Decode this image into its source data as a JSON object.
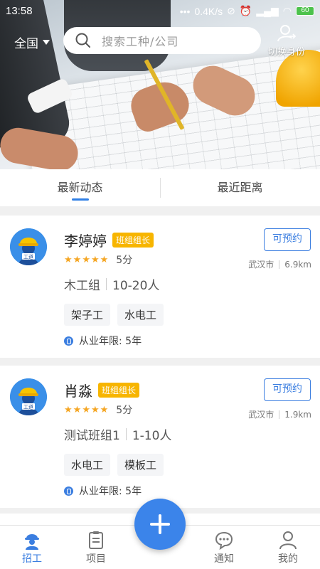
{
  "status": {
    "time": "13:58",
    "network_speed": "0.4K/s",
    "battery": "60"
  },
  "header": {
    "city": "全国",
    "search_placeholder": "搜索工种/公司",
    "switch_label": "切换身份"
  },
  "tabs": [
    {
      "label": "最新动态",
      "active": true
    },
    {
      "label": "最近距离",
      "active": false
    }
  ],
  "workers": [
    {
      "name": "李婷婷",
      "role_badge": "班组组长",
      "rating": 5,
      "score_label": "5分",
      "team": "木工组",
      "size": "10-20人",
      "skills": [
        "架子工",
        "水电工"
      ],
      "years_label": "从业年限: 5年",
      "city": "武汉市",
      "distance": "6.9km",
      "book_label": "可预约",
      "avatar_text": "工道"
    },
    {
      "name": "肖淼",
      "role_badge": "班组组长",
      "rating": 5,
      "score_label": "5分",
      "team": "测试班组1",
      "size": "1-10人",
      "skills": [
        "水电工",
        "模板工"
      ],
      "years_label": "从业年限: 5年",
      "city": "武汉市",
      "distance": "1.9km",
      "book_label": "可预约",
      "avatar_text": "工道"
    }
  ],
  "bottom_nav": [
    {
      "label": "招工",
      "icon": "worker-icon",
      "active": true
    },
    {
      "label": "项目",
      "icon": "clipboard-icon",
      "active": false
    },
    {
      "label": "",
      "icon": "add-icon",
      "active": false
    },
    {
      "label": "通知",
      "icon": "chat-icon",
      "active": false
    },
    {
      "label": "我的",
      "icon": "person-icon",
      "active": false
    }
  ],
  "colors": {
    "accent": "#3b7ee0",
    "badge": "#f7b500",
    "star": "#f5a623"
  }
}
